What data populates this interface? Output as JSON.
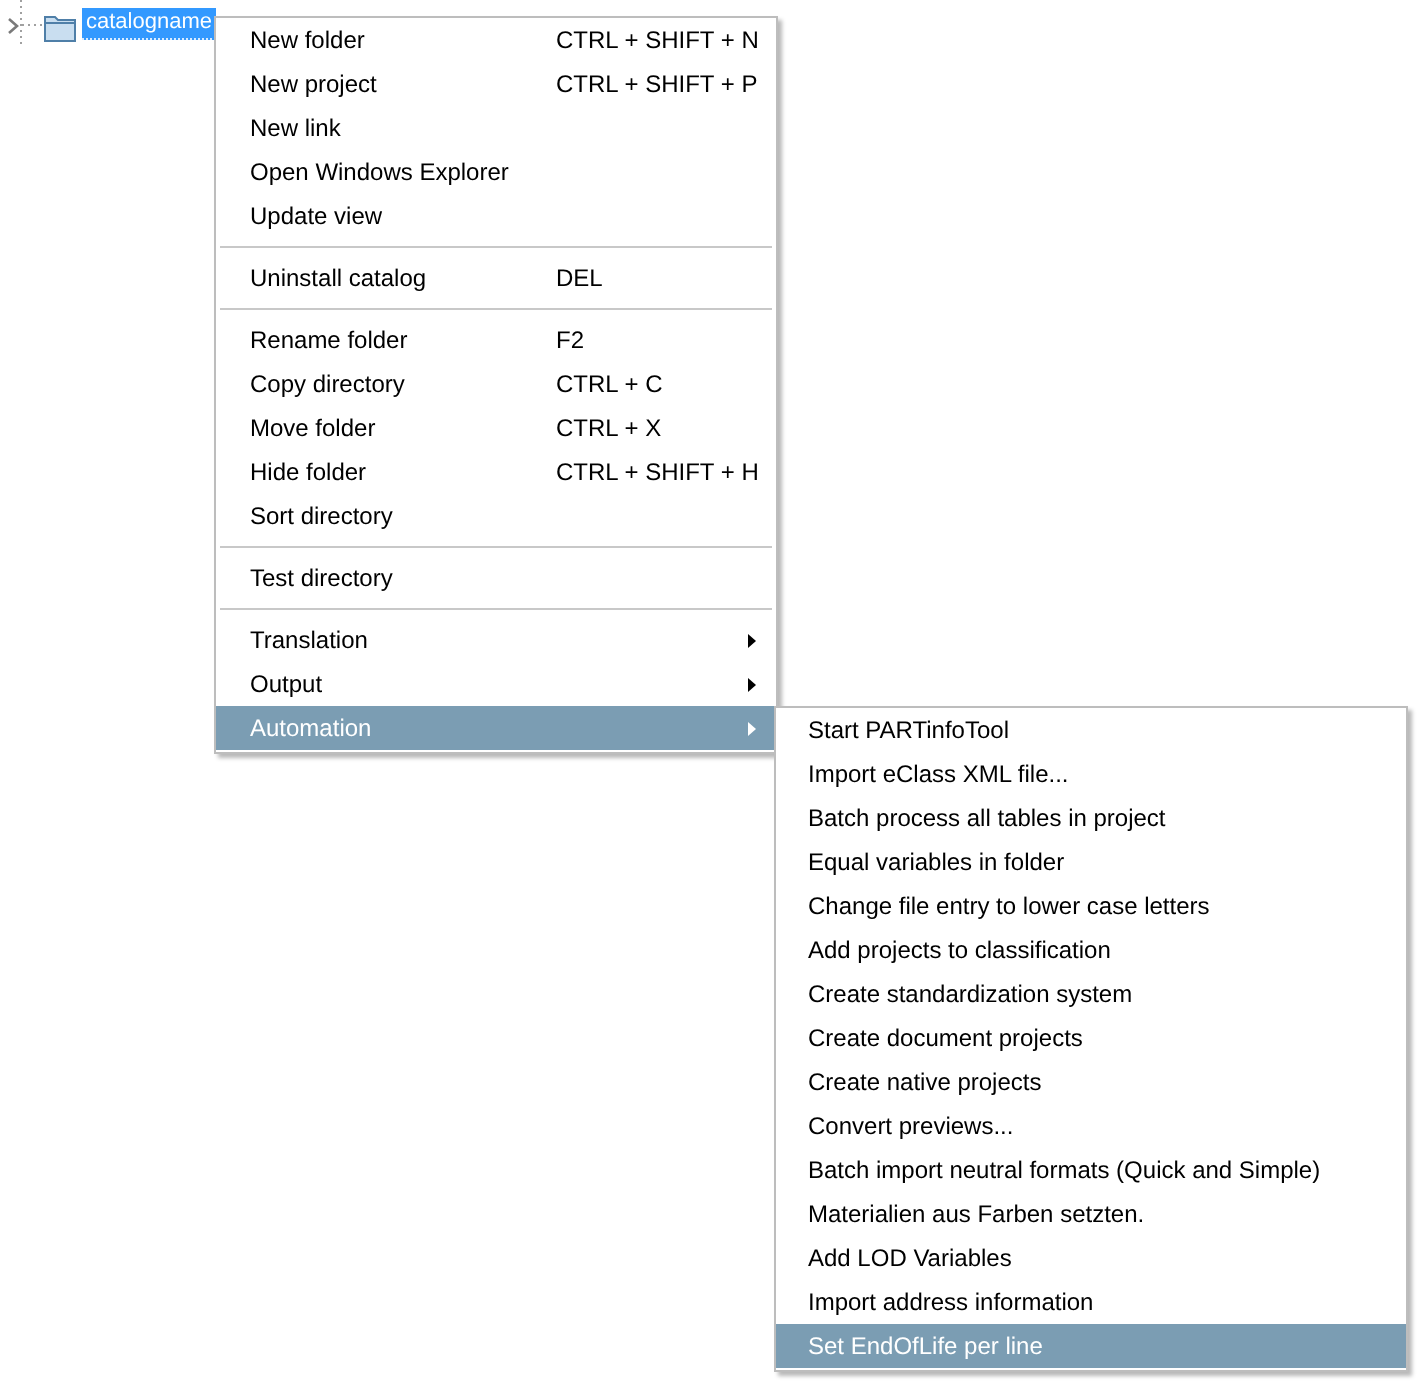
{
  "tree": {
    "items": [
      {
        "label": "catalogname",
        "selected": true,
        "expanded": false
      }
    ]
  },
  "context_menu": {
    "groups": [
      {
        "items": [
          {
            "kind": "command",
            "label": "New folder",
            "shortcut": "CTRL + SHIFT + N",
            "selected": false
          },
          {
            "kind": "command",
            "label": "New project",
            "shortcut": "CTRL + SHIFT + P",
            "selected": false
          },
          {
            "kind": "command",
            "label": "New link",
            "selected": false
          },
          {
            "kind": "command",
            "label": "Open Windows Explorer",
            "selected": false
          },
          {
            "kind": "command",
            "label": "Update view",
            "selected": false
          }
        ]
      },
      {
        "items": [
          {
            "kind": "command",
            "label": "Uninstall catalog",
            "shortcut": "DEL",
            "selected": false
          }
        ]
      },
      {
        "items": [
          {
            "kind": "command",
            "label": "Rename folder",
            "shortcut": "F2",
            "selected": false
          },
          {
            "kind": "command",
            "label": "Copy directory",
            "shortcut": "CTRL + C",
            "selected": false
          },
          {
            "kind": "command",
            "label": "Move folder",
            "shortcut": "CTRL + X",
            "selected": false
          },
          {
            "kind": "command",
            "label": "Hide folder",
            "shortcut": "CTRL + SHIFT + H",
            "selected": false
          },
          {
            "kind": "command",
            "label": "Sort directory",
            "selected": false
          }
        ]
      },
      {
        "items": [
          {
            "kind": "command",
            "label": "Test directory",
            "selected": false
          }
        ]
      },
      {
        "items": [
          {
            "kind": "submenu",
            "label": "Translation",
            "selected": false
          },
          {
            "kind": "submenu",
            "label": "Output",
            "selected": false
          },
          {
            "kind": "submenu",
            "label": "Automation",
            "selected": true
          }
        ]
      }
    ]
  },
  "submenu": {
    "items": [
      {
        "label": "Start PARTinfoTool",
        "selected": false
      },
      {
        "label": "Import eClass XML file...",
        "selected": false
      },
      {
        "label": "Batch process all tables in project",
        "selected": false
      },
      {
        "label": "Equal variables in folder",
        "selected": false
      },
      {
        "label": "Change file entry to lower case letters",
        "selected": false
      },
      {
        "label": "Add projects to classification",
        "selected": false
      },
      {
        "label": "Create standardization system",
        "selected": false
      },
      {
        "label": "Create document projects",
        "selected": false
      },
      {
        "label": "Create native projects",
        "selected": false
      },
      {
        "label": "Convert previews...",
        "selected": false
      },
      {
        "label": "Batch import neutral formats (Quick and Simple)",
        "selected": false
      },
      {
        "label": "Materialien aus Farben setzten.",
        "selected": false
      },
      {
        "label": "Add LOD Variables",
        "selected": false
      },
      {
        "label": "Import address information",
        "selected": false
      },
      {
        "label": "Set EndOfLife per line",
        "selected": true
      }
    ]
  }
}
